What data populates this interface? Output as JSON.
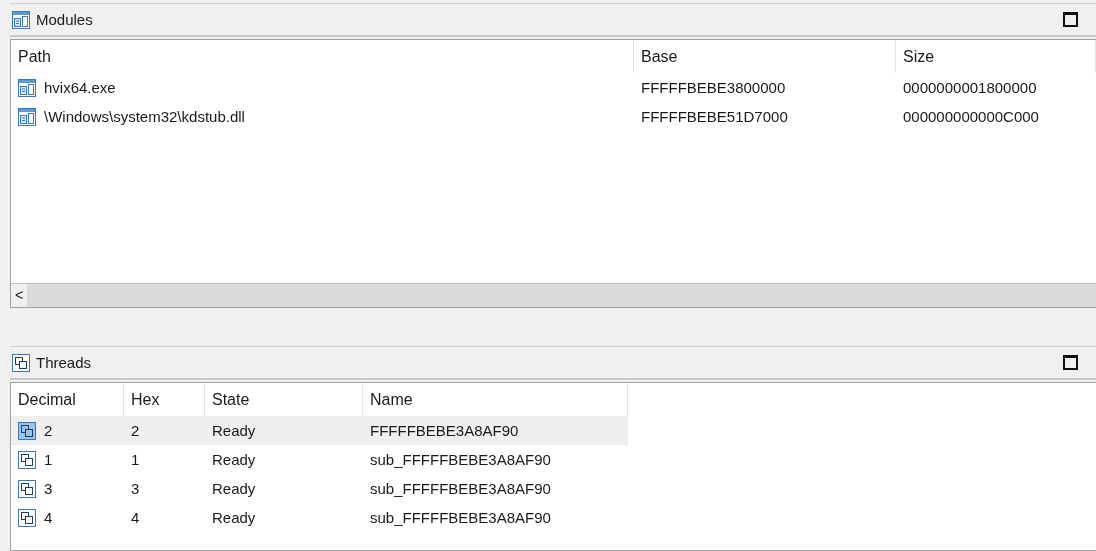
{
  "panels": [
    {
      "title": "Modules",
      "kind": "modules",
      "columns": [
        "Path",
        "Base",
        "Size"
      ],
      "rows": [
        {
          "cells": [
            "hvix64.exe",
            "FFFFFBEBE3800000",
            "0000000001800000"
          ]
        },
        {
          "cells": [
            "\\Windows\\system32\\kdstub.dll",
            "FFFFFBEBE51D7000",
            "000000000000C000"
          ]
        }
      ],
      "scroll_left": "<"
    },
    {
      "title": "Threads",
      "kind": "threads",
      "columns": [
        "Decimal",
        "Hex",
        "State",
        "Name"
      ],
      "rows": [
        {
          "cells": [
            "2",
            "2",
            "Ready",
            "FFFFFBEBE3A8AF90"
          ],
          "selected": true
        },
        {
          "cells": [
            "1",
            "1",
            "Ready",
            "sub_FFFFFBEBE3A8AF90"
          ],
          "selected": false
        },
        {
          "cells": [
            "3",
            "3",
            "Ready",
            "sub_FFFFFBEBE3A8AF90"
          ],
          "selected": false
        },
        {
          "cells": [
            "4",
            "4",
            "Ready",
            "sub_FFFFFBEBE3A8AF90"
          ],
          "selected": false
        }
      ]
    }
  ]
}
